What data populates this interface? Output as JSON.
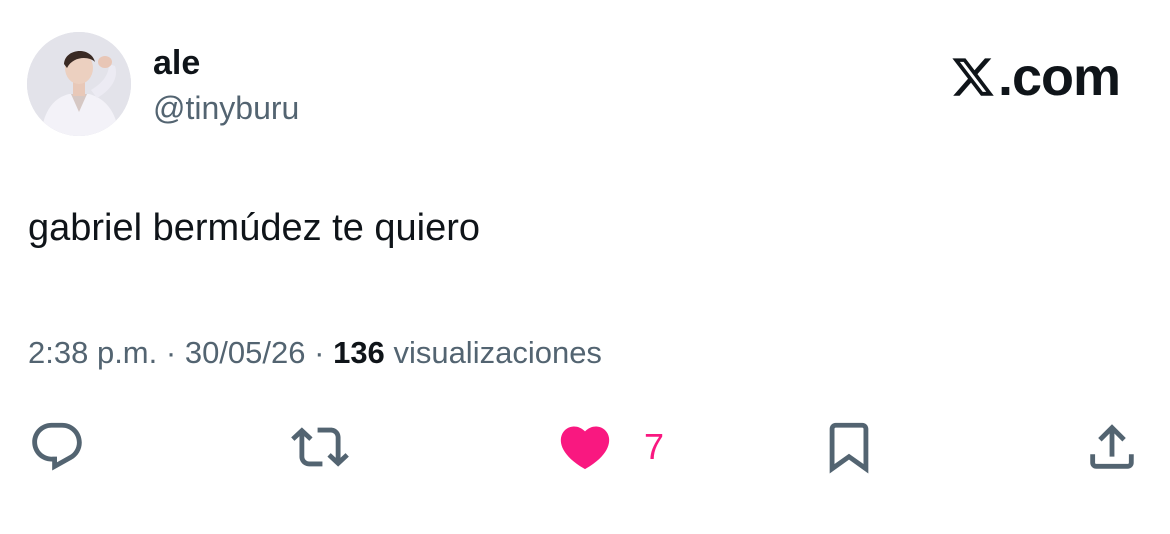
{
  "author": {
    "display_name": "ale",
    "handle": "@tinyburu"
  },
  "brand": {
    "text": ".com",
    "logo_icon": "x-logo-icon"
  },
  "tweet": {
    "text": "gabriel bermúdez te quiero"
  },
  "meta": {
    "time": "2:38 p.m.",
    "separator": "·",
    "date": "30/05/26",
    "views_count": "136",
    "views_label": "visualizaciones"
  },
  "actions": {
    "reply_icon": "reply-icon",
    "retweet_icon": "retweet-icon",
    "like_icon": "heart-filled-icon",
    "like_count": "7",
    "bookmark_icon": "bookmark-icon",
    "share_icon": "share-icon"
  },
  "colors": {
    "text_primary": "#0f1419",
    "text_secondary": "#536471",
    "like_active": "#f91880"
  }
}
